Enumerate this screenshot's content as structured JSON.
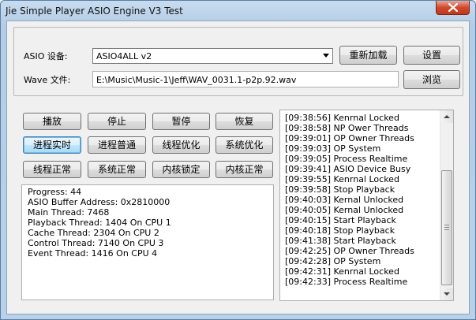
{
  "window": {
    "title": "Jie Simple Player ASIO Engine V3 Test"
  },
  "asio": {
    "label": "ASIO 设备:",
    "selected": "ASIO4ALL v2",
    "reload_label": "重新加载",
    "settings_label": "设置"
  },
  "wave": {
    "label": "Wave 文件:",
    "path": "E:\\Music\\Music-1\\Jeff\\WAV_0031.1-p2p.92.wav",
    "browse_label": "浏览"
  },
  "controls": {
    "play": "播放",
    "stop": "停止",
    "pause": "暂停",
    "resume": "恢复",
    "thread_realtime": "进程实时",
    "thread_normal": "进程普通",
    "thread_optimize": "线程优化",
    "system_optimize": "系统优化",
    "thread_regular": "线程正常",
    "system_regular": "系统正常",
    "core_lock": "内核锁定",
    "core_regular": "内核正常"
  },
  "info": {
    "lines": [
      "Progress: 44",
      "ASIO Buffer Address: 0x2810000",
      "Main Thread: 7468",
      "Playback Thread: 1404 On CPU 1",
      "Cache Thread: 2304 On CPU 2",
      "Control Thread: 7140 On CPU 3",
      "Event Thread: 1416 On CPU 4"
    ]
  },
  "log": {
    "lines": [
      "[09:38:56] Kenrnal Locked",
      "[09:38:58] NP Ower Threads",
      "[09:39:01] OP Owner Threads",
      "[09:39:03] OP System",
      "[09:39:05] Process Realtime",
      "[09:39:41] ASIO Device Busy",
      "[09:39:55] Kenrnal Locked",
      "[09:39:58] Stop Playback",
      "[09:40:03] Kernal Unlocked",
      "[09:40:05] Kernal Unlocked",
      "[09:40:15] Start Playback",
      "[09:40:18] Stop Playback",
      "[09:41:38] Start Playback",
      "[09:42:25] OP Owner Threads",
      "[09:42:28] OP System",
      "[09:42:31] Kenrnal Locked",
      "[09:42:33] Process Realtime"
    ]
  },
  "colors": {
    "close_button": "#c94a30",
    "focus_border": "#3c7fb1"
  }
}
